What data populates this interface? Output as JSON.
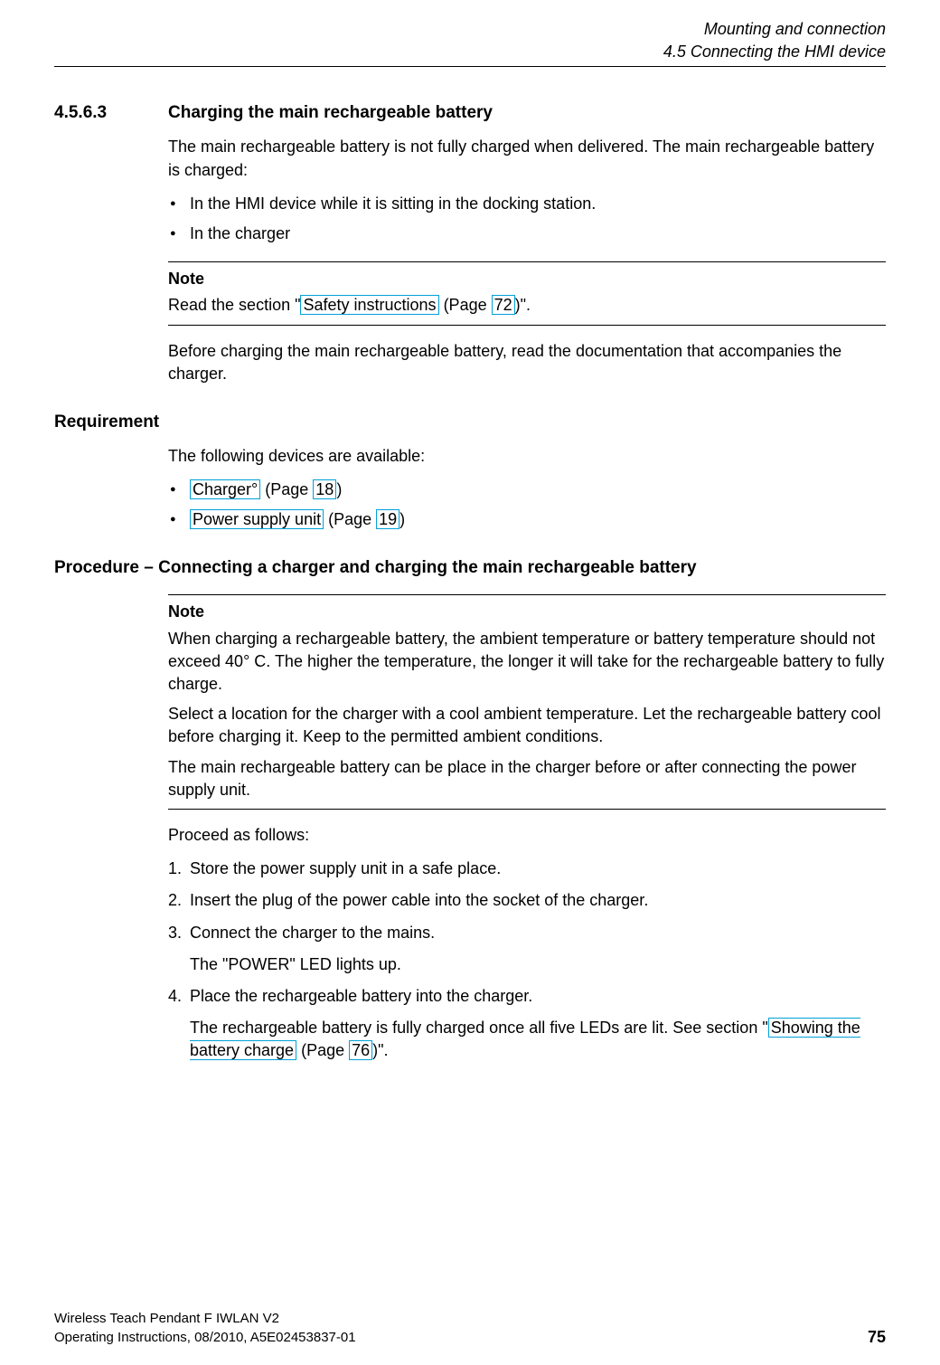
{
  "header": {
    "chapter": "Mounting and connection",
    "section": "4.5 Connecting the HMI device"
  },
  "sec": {
    "number": "4.5.6.3",
    "title": "Charging the main rechargeable battery"
  },
  "intro": {
    "p1": "The main rechargeable battery is not fully charged when delivered. The main rechargeable battery is charged:",
    "li1": "In the HMI device while it is sitting in the docking station.",
    "li2": "In the charger"
  },
  "note1": {
    "title": "Note",
    "pre": "Read the section \"",
    "link_text": "Safety instructions",
    "mid": " (Page ",
    "page": "72",
    "post": ")\"."
  },
  "p_before": "Before charging the main rechargeable battery, read the documentation that accompanies the charger.",
  "req": {
    "heading": "Requirement",
    "intro": "The following devices are available:",
    "li1": {
      "text": "Charger°",
      "mid": " (Page ",
      "page": "18",
      "post": ")"
    },
    "li2": {
      "text": "Power supply unit",
      "mid": " (Page ",
      "page": "19",
      "post": ")"
    }
  },
  "proc": {
    "heading": "Procedure – Connecting a charger and charging the main rechargeable battery"
  },
  "note2": {
    "title": "Note",
    "p1": "When charging a rechargeable battery, the ambient temperature or battery temperature should not exceed 40° C. The higher the temperature, the longer it will take for the rechargeable battery to fully charge.",
    "p2": "Select a location for the charger with a cool ambient temperature. Let the rechargeable battery cool before charging it. Keep to the permitted ambient conditions.",
    "p3": "The main rechargeable battery can be place in the charger before or after connecting the power supply unit."
  },
  "steps": {
    "intro": "Proceed as follows:",
    "s1": "Store the power supply unit in a safe place.",
    "s2": "Insert the plug of the power cable into the socket of the charger.",
    "s3": "Connect the charger to the mains.",
    "s3sub": "The \"POWER\" LED lights up.",
    "s4": "Place the rechargeable battery into the charger.",
    "s4sub_pre": "The rechargeable battery is fully charged once all five LEDs are lit. See section \"",
    "s4sub_link": "Showing the battery charge",
    "s4sub_mid": " (Page ",
    "s4sub_page": "76",
    "s4sub_post": ")\"."
  },
  "footer": {
    "l1": "Wireless Teach Pendant F IWLAN V2",
    "l2": "Operating Instructions, 08/2010, A5E02453837-01",
    "page": "75"
  }
}
